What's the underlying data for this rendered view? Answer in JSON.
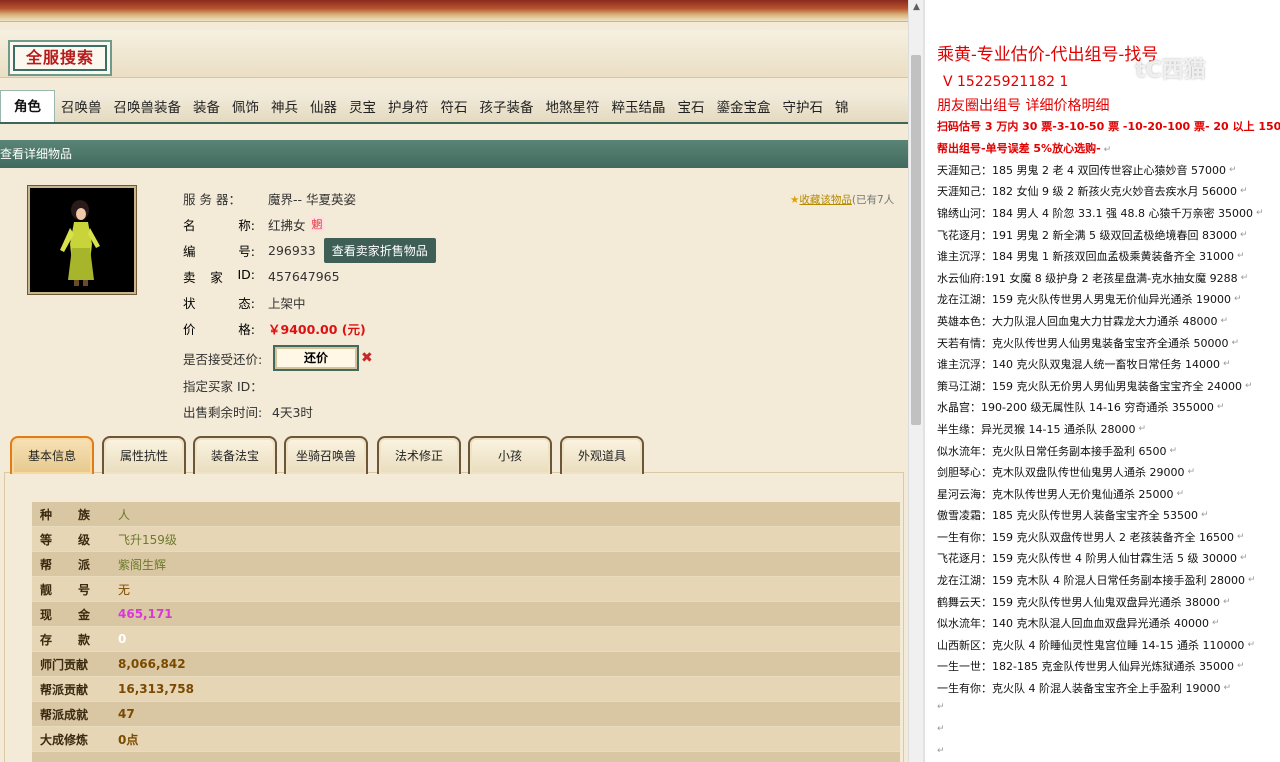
{
  "search_badge": "全服搜索",
  "categories": [
    {
      "label": "角色",
      "active": true
    },
    {
      "label": "召唤兽"
    },
    {
      "label": "召唤兽装备"
    },
    {
      "label": "装备"
    },
    {
      "label": "佩饰"
    },
    {
      "label": "神兵"
    },
    {
      "label": "仙器"
    },
    {
      "label": "灵宝"
    },
    {
      "label": "护身符"
    },
    {
      "label": "符石"
    },
    {
      "label": "孩子装备"
    },
    {
      "label": "地煞星符"
    },
    {
      "label": "粹玉结晶"
    },
    {
      "label": "宝石"
    },
    {
      "label": "鎏金宝盒"
    },
    {
      "label": "守护石"
    },
    {
      "label": "锦"
    }
  ],
  "detail_bar_label": "查看详细物品",
  "info": {
    "server_label": "服 务 器：",
    "server_value": "魔界-- 华夏英姿",
    "name_k1": "名",
    "name_k2": "称:",
    "name_value": "红拂女",
    "name_badge": "魍",
    "id_k1": "编",
    "id_k2": "号:",
    "id_value": "296933",
    "seller_btn": "查看卖家折售物品",
    "seller_k1": "卖",
    "seller_k2": "家",
    "seller_k3": "ID:",
    "seller_value": "457647965",
    "status_k1": "状",
    "status_k2": "态:",
    "status_value": "上架中",
    "price_k1": "价",
    "price_k2": "格:",
    "price_value": "￥9400.00 (元)",
    "counter_label": "是否接受还价:",
    "counter_btn": "还价",
    "buyer_label": "指定买家 ID：",
    "time_label": "出售剩余时间:",
    "time_value": "4天3时"
  },
  "watch": {
    "link": "收藏该物品",
    "count": "(已有7人"
  },
  "tabs": [
    "基本信息",
    "属性抗性",
    "装备法宝",
    "坐骑召唤兽",
    "法术修正",
    "小孩",
    "外观道具"
  ],
  "attributes": [
    {
      "k1": "种",
      "k2": "族",
      "v": "人",
      "color": "#6e7a2e"
    },
    {
      "k1": "等",
      "k2": "级",
      "v": "飞升159级",
      "color": "#6e7a2e"
    },
    {
      "k1": "帮",
      "k2": "派",
      "v": "紫阁生辉",
      "color": "#6e7a2e"
    },
    {
      "k1": "靓",
      "k2": "号",
      "v": "无",
      "color": "#7a4a00"
    },
    {
      "k1": "现",
      "k2": "金",
      "v": "465,171",
      "color": "#d63ad6"
    },
    {
      "k1": "存",
      "k2": "款",
      "v": "0",
      "color": "#ffffff"
    },
    {
      "k": "师门贡献",
      "v": "8,066,842",
      "color": "#7a4a00"
    },
    {
      "k": "帮派贡献",
      "v": "16,313,758",
      "color": "#7a4a00"
    },
    {
      "k": "帮派成就",
      "v": "47",
      "color": "#7a4a00"
    },
    {
      "k": "大成修炼",
      "v": "0点",
      "color": "#7a4a00"
    },
    {
      "k": "",
      "v": "",
      "color": "#7a4a00"
    }
  ],
  "doc": {
    "hd1": "乘黄-专业估价-代出组号-找号",
    "hd2": "V 15225921182    1",
    "hd3": "朋友圈出组号   详细价格明细",
    "hd4": "扫码估号 3 万内 30 票-3-10-50 票  -10-20-100 票- 20 以上 150",
    "hd5": "帮出组号-单号误差 5%放心选购-",
    "watermark": "tC西猫",
    "pilcrow": "↵",
    "listings": [
      "天涯知己：185 男鬼 2 老 4 双回传世容止心猿妙音 57000",
      "天涯知己：182 女仙 9 级 2 新孩火克火妙音去疾水月 56000",
      "锦绣山河：184 男人 4 阶忽 33.1 强 48.8 心猿千万亲密 35000",
      "飞花逐月：191 男鬼 2 新全满 5 级双回孟极绝境春回 83000",
      "谁主沉浮：184 男鬼 1 新孩双回血孟极乘黄装备齐全 31000",
      "水云仙府:191 女魔 8 级护身 2 老孩星盘满-克水抽女魔 9288",
      "龙在江湖：159 克火队传世男人男鬼无价仙异光通杀 19000",
      "英雄本色：大力队混人回血鬼大力甘霖龙大力通杀 48000",
      "天若有情：克火队传世男人仙男鬼装备宝宝齐全通杀 50000",
      "谁主沉浮：140 克火队双鬼混人统一畜牧日常任务 14000",
      "策马江湖：159 克火队无价男人男仙男鬼装备宝宝齐全 24000",
      "水晶宫：190-200 级无属性队 14-16 穷奇通杀 355000",
      "半生缘：异光灵猴 14-15 通杀队 28000",
      "似水流年：克火队日常任务副本接手盈利 6500",
      "剑胆琴心：克木队双盘队传世仙鬼男人通杀 29000",
      "星河云海：克木队传世男人无价鬼仙通杀 25000",
      "傲雪凌霜：185 克火队传世男人装备宝宝齐全 53500",
      "一生有你：159 克火队双盘传世男人 2 老孩装备齐全 16500",
      "飞花逐月：159 克火队传世 4 阶男人仙甘霖生活 5 级 30000",
      "龙在江湖：159 克木队 4 阶混人日常任务副本接手盈利 28000",
      "鹤舞云天：159 克火队传世男人仙鬼双盘异光通杀 38000",
      "似水流年：140 克木队混人回血血双盘异光通杀 40000",
      "山西新区：克火队 4 阶睡仙灵性鬼宫位睡 14-15 通杀 110000",
      "一生一世：182-185 克金队传世男人仙异光炼狱通杀 35000",
      "一生有你：克火队 4 阶混人装备宝宝齐全上手盈利 19000"
    ]
  }
}
